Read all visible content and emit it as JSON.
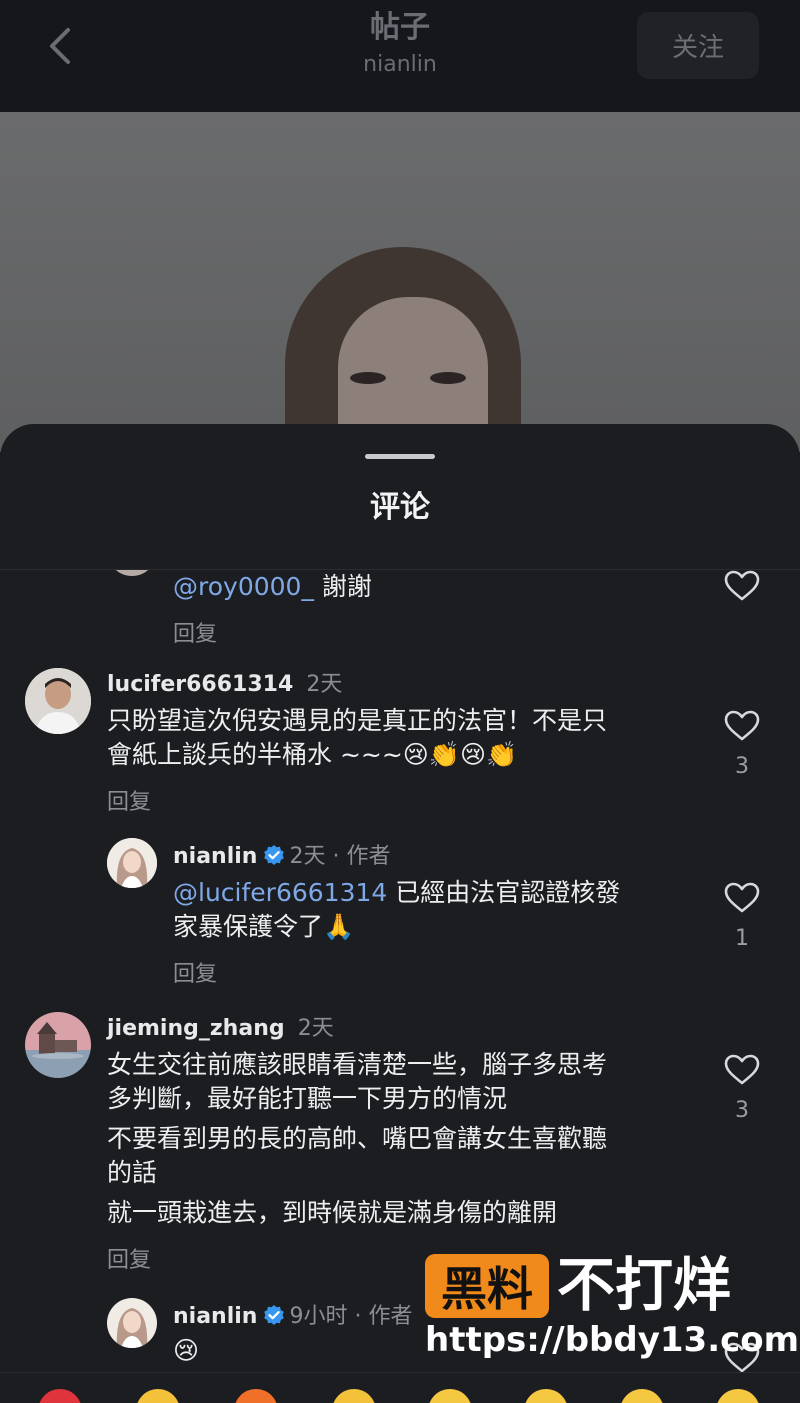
{
  "header": {
    "title": "帖子",
    "subtitle": "nianlin",
    "follow_label": "关注"
  },
  "sheet": {
    "title": "评论"
  },
  "comments": {
    "top_reply": {
      "mention": "@roy0000_",
      "text": " 謝謝",
      "reply_label": "回复"
    },
    "c1": {
      "username": "lucifer6661314",
      "time": "2天",
      "lines": [
        "只盼望這次倪安遇見的是真正的法官！不是只",
        "會紙上談兵的半桶水 ~~~😢👏😢👏"
      ],
      "reply_label": "回复",
      "likes": "3"
    },
    "r1": {
      "username": "nianlin",
      "time": "2天 · 作者",
      "mention": "@lucifer6661314",
      "line1": " 已經由法官認證核發",
      "line2": "家暴保護令了🙏",
      "reply_label": "回复",
      "likes": "1"
    },
    "c2": {
      "username": "jieming_zhang",
      "time": "2天",
      "lines": [
        "女生交往前應該眼睛看清楚一些，腦子多思考",
        "多判斷，最好能打聽一下男方的情況",
        "不要看到男的長的高帥、嘴巴會講女生喜歡聽",
        "的話",
        "就一頭栽進去，到時候就是滿身傷的離開"
      ],
      "reply_label": "回复",
      "likes": "3"
    },
    "r2": {
      "username": "nianlin",
      "time": "9小时 · 作者",
      "text": "😢"
    }
  },
  "watermark": {
    "badge": "黑料",
    "text": "不打烊",
    "url": "https://bbdy13.com"
  },
  "icons": {
    "back": "chevron-left-icon",
    "heart": "heart-outline-icon",
    "verified": "verified-badge-icon"
  },
  "colors": {
    "mention": "#7fa8e6",
    "verified": "#3897f0",
    "watermark": "#f08a1a"
  }
}
